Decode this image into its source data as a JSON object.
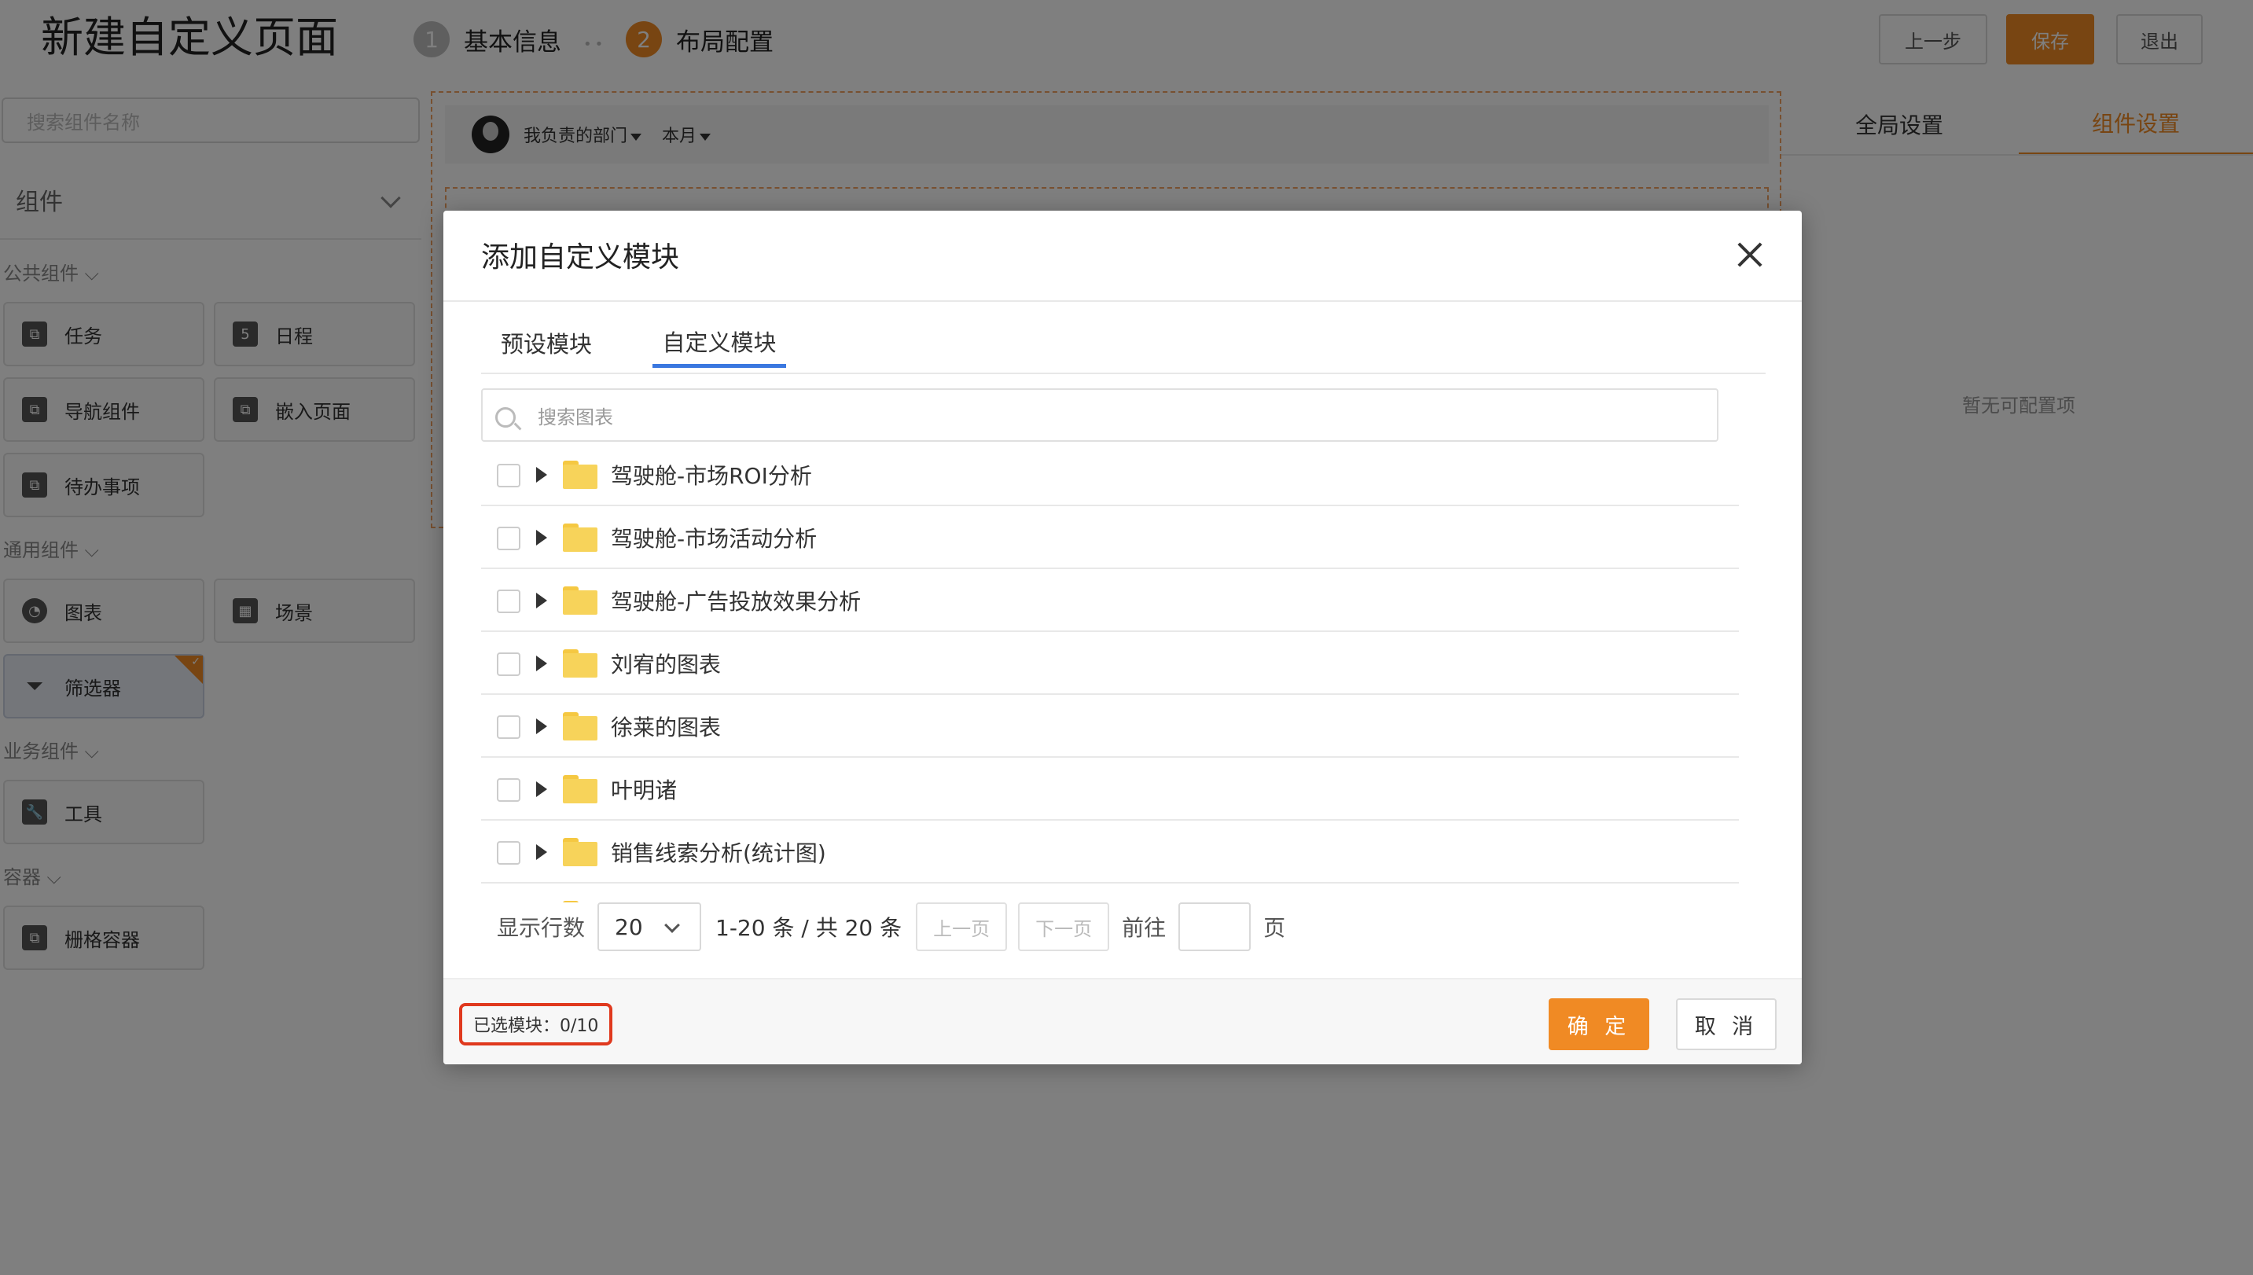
{
  "header": {
    "title": "新建自定义页面",
    "steps": [
      {
        "num": "1",
        "label": "基本信息",
        "state": "done",
        "color": "#bfbfbf"
      },
      {
        "num": "2",
        "label": "布局配置",
        "state": "current",
        "color": "#f08a24"
      }
    ],
    "step_separator": "••",
    "buttons": {
      "prev": "上一步",
      "save": "保存",
      "exit": "退出"
    }
  },
  "left_panel": {
    "search_placeholder": "搜索组件名称",
    "section_title": "组件",
    "groups": [
      {
        "label": "公共组件",
        "items": [
          {
            "label": "任务",
            "icon": "component-icon"
          },
          {
            "label": "日程",
            "icon": "calendar-icon"
          },
          {
            "label": "导航组件",
            "icon": "component-icon"
          },
          {
            "label": "嵌入页面",
            "icon": "component-icon"
          },
          {
            "label": "待办事项",
            "icon": "component-icon"
          }
        ]
      },
      {
        "label": "通用组件",
        "items": [
          {
            "label": "图表",
            "icon": "pie-chart-icon"
          },
          {
            "label": "场景",
            "icon": "layout-icon"
          },
          {
            "label": "筛选器",
            "icon": "filter-icon",
            "selected": true
          }
        ]
      },
      {
        "label": "业务组件",
        "items": [
          {
            "label": "工具",
            "icon": "wrench-icon"
          }
        ]
      },
      {
        "label": "容器",
        "items": [
          {
            "label": "栅格容器",
            "icon": "component-icon"
          }
        ]
      }
    ],
    "calendar_day": "5"
  },
  "canvas": {
    "filter_dept": "我负责的部门",
    "filter_period": "本月"
  },
  "right_panel": {
    "tabs": [
      {
        "label": "全局设置",
        "active": false
      },
      {
        "label": "组件设置",
        "active": true
      }
    ],
    "empty_text": "暂无可配置项"
  },
  "modal": {
    "title": "添加自定义模块",
    "tabs": [
      {
        "label": "预设模块",
        "active": false
      },
      {
        "label": "自定义模块",
        "active": true
      }
    ],
    "search_placeholder": "搜索图表",
    "rows": [
      "驾驶舱-市场ROI分析",
      "驾驶舱-市场活动分析",
      "驾驶舱-广告投放效果分析",
      "刘宥的图表",
      "徐莱的图表",
      "叶明诸",
      "销售线索分析(统计图)"
    ],
    "pager": {
      "rows_label": "显示行数",
      "page_size": "20",
      "range": "1-20 条 / 共 20 条",
      "prev": "上一页",
      "next": "下一页",
      "goto_label": "前往",
      "page_unit": "页"
    },
    "footer": {
      "selected": "已选模块：0/10",
      "ok": "确 定",
      "cancel": "取 消"
    }
  },
  "colors": {
    "accent": "#f08a24",
    "tab_underline": "#3a78e0",
    "highlight_border": "#e0391e"
  }
}
